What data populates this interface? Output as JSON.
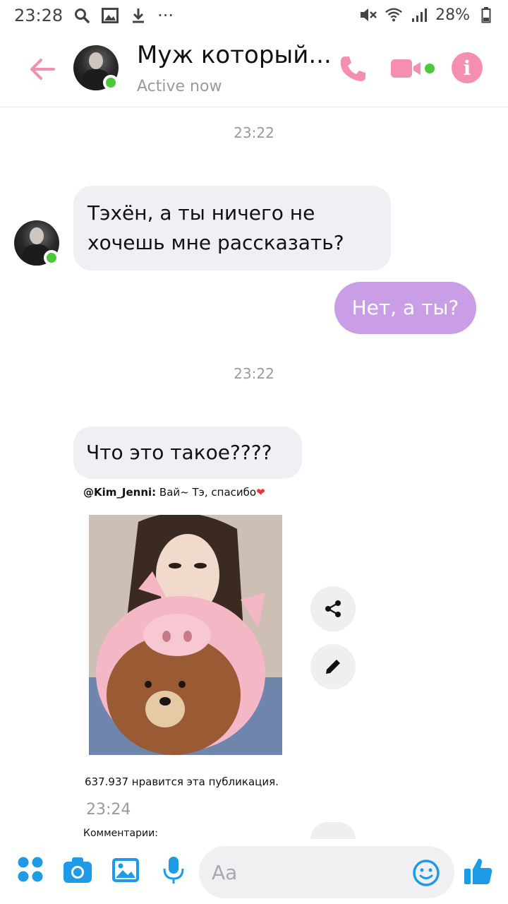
{
  "status_bar": {
    "time": "23:28",
    "battery": "28%",
    "more": "···"
  },
  "header": {
    "title": "Муж который...",
    "status": "Active now"
  },
  "messages": {
    "time_1": "23:22",
    "in_1_line1": "Тэхён, а ты ничего не",
    "in_1_line2": "хочешь мне рассказать?",
    "out_1": "Нет, а ты?",
    "time_2": "23:22",
    "in_2": "Что это такое????"
  },
  "post": {
    "caption_user": "@Kim_Jenni:",
    "caption_text": " Вай~ Тэ, спасибо",
    "likes": "637.937 нравится эта публикация.",
    "time": "23:24",
    "comments": "Комментарии:"
  },
  "composer": {
    "placeholder": "Aa"
  },
  "colors": {
    "accent_pink": "#f48fb1",
    "bubble_out": "#c99ee6",
    "bubble_in": "#f0eff4",
    "online": "#4cc93a",
    "composer_blue": "#1e9be6"
  },
  "icons": [
    "back-arrow-icon",
    "phone-icon",
    "video-camera-icon",
    "info-icon",
    "share-icon",
    "pencil-icon",
    "apps-icon",
    "camera-icon",
    "gallery-icon",
    "microphone-icon",
    "emoji-icon",
    "thumbs-up-icon"
  ]
}
